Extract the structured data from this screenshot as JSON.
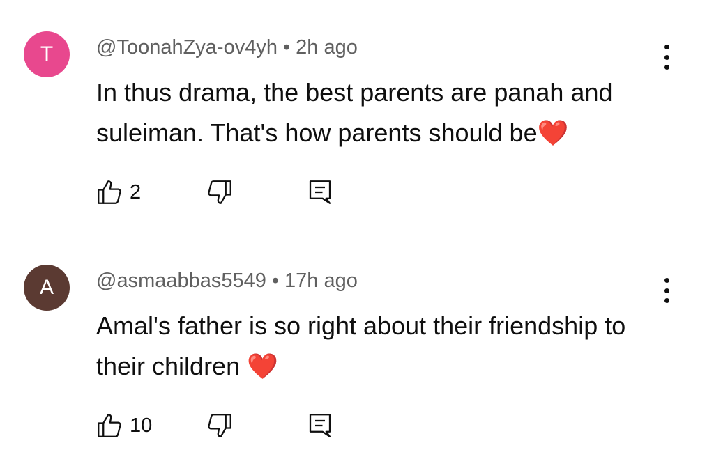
{
  "comments": [
    {
      "avatar_letter": "T",
      "avatar_color": "#e8488e",
      "author": "@ToonahZya-ov4yh",
      "separator": "•",
      "time": "2h ago",
      "text": "In thus drama, the best parents are panah and suleiman. That's how parents should be",
      "emoji": "❤️",
      "like_count": "2",
      "more_icon": "more-vertical-icon",
      "like_icon": "thumbs-up-icon",
      "dislike_icon": "thumbs-down-icon",
      "reply_icon": "reply-comment-icon"
    },
    {
      "avatar_letter": "A",
      "avatar_color": "#5b3a32",
      "author": "@asmaabbas5549",
      "separator": "•",
      "time": "17h ago",
      "text": "Amal's father is so right about their friendship to their children ",
      "emoji": "❤️",
      "like_count": "10",
      "more_icon": "more-vertical-icon",
      "like_icon": "thumbs-up-icon",
      "dislike_icon": "thumbs-down-icon",
      "reply_icon": "reply-comment-icon"
    }
  ]
}
